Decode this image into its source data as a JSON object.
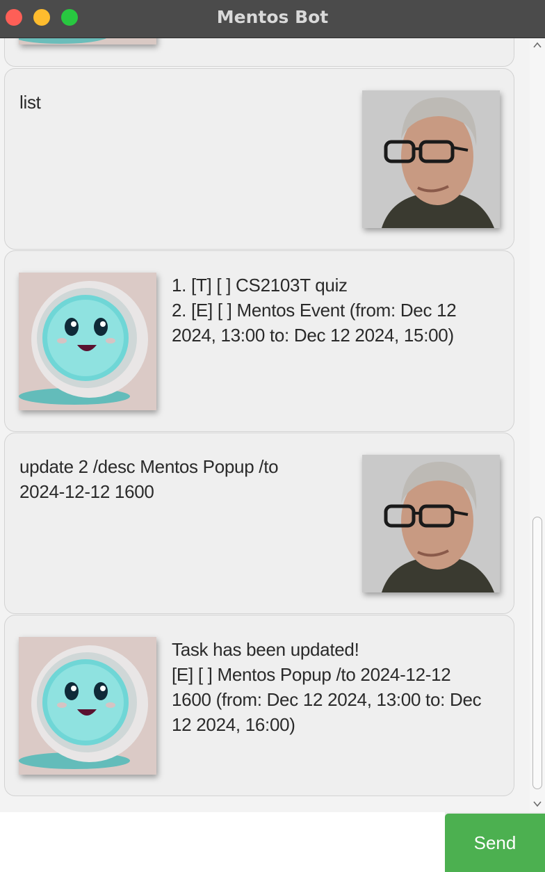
{
  "window": {
    "title": "Mentos Bot",
    "traffic_lights": {
      "close": "#fe5f57",
      "minimize": "#febc2e",
      "zoom": "#28c840"
    }
  },
  "messages": [
    {
      "sender": "user",
      "avatar": "user-avatar-photo",
      "lines": [
        "list"
      ]
    },
    {
      "sender": "bot",
      "avatar": "bot-avatar-mentos",
      "lines": [
        "1. [T] [ ] CS2103T quiz",
        "2. [E] [ ] Mentos Event (from: Dec 12",
        "2024, 13:00 to: Dec 12 2024, 15:00)"
      ]
    },
    {
      "sender": "user",
      "avatar": "user-avatar-photo",
      "lines": [
        "update 2 /desc Mentos Popup /to",
        "2024-12-12 1600"
      ]
    },
    {
      "sender": "bot",
      "avatar": "bot-avatar-mentos",
      "lines": [
        "Task has been updated!",
        "[E] [ ] Mentos Popup /to 2024-12-12",
        "1600 (from: Dec 12 2024, 13:00 to: Dec",
        "12 2024, 16:00)"
      ]
    }
  ],
  "input": {
    "value": "",
    "placeholder": ""
  },
  "send_button": {
    "label": "Send",
    "color": "#4cb050"
  }
}
